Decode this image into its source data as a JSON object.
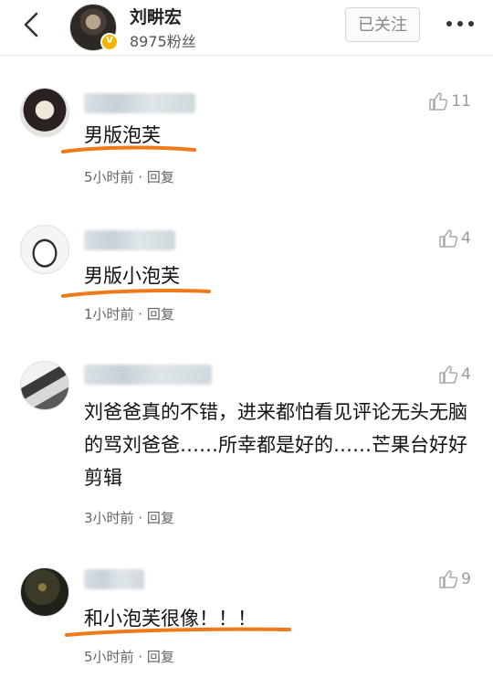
{
  "header": {
    "back_icon": "chevron-left-icon",
    "user_name": "刘畊宏",
    "fans": "8975粉丝",
    "verified_icon": "verified-badge-icon",
    "follow_label": "已关注",
    "more_icon": "more-dots-icon"
  },
  "comments": [
    {
      "text": "男版泡芙",
      "likes": "11",
      "meta": "5小时前 · 回复"
    },
    {
      "text": "男版小泡芙",
      "likes": "4",
      "meta": "1小时前 · 回复"
    },
    {
      "text": "刘爸爸真的不错，进来都怕看见评论无头无脑的骂刘爸爸……所幸都是好的……芒果台好好剪辑",
      "likes": "4",
      "meta": "3小时前 · 回复"
    },
    {
      "text": "和小泡芙很像！！！",
      "likes": "9",
      "meta": "5小时前 · 回复"
    }
  ],
  "colors": {
    "highlight_underline": "#f07a1a",
    "like_icon": "#a8a8a8",
    "verified": "#f4b400"
  }
}
